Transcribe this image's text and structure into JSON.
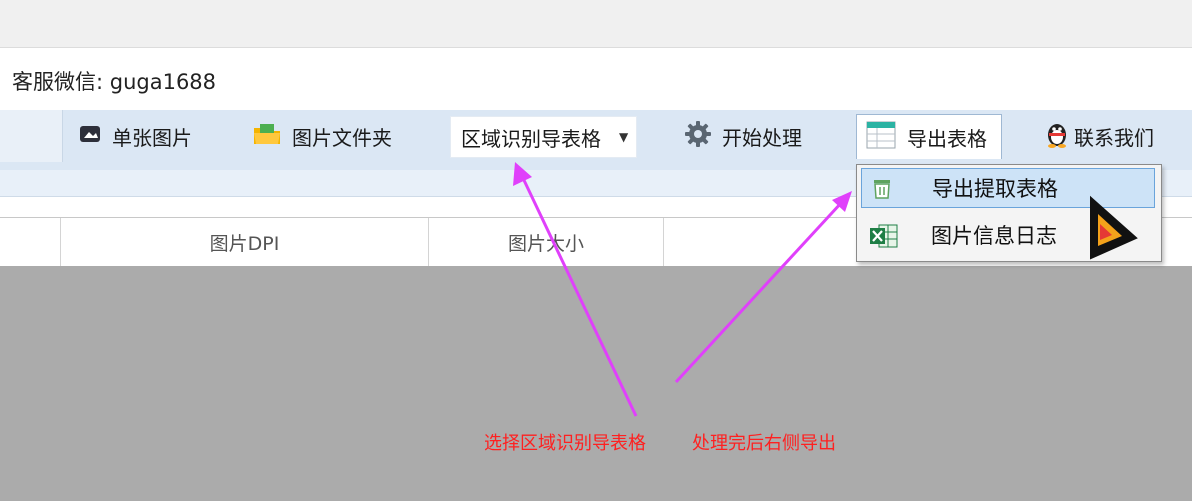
{
  "header": {
    "support_text": "客服微信: guga1688"
  },
  "toolbar": {
    "single_image": "单张图片",
    "image_folder": "图片文件夹",
    "mode_combo": "区域识别导表格",
    "start_process": "开始处理",
    "export_table": "导出表格",
    "contact_us": "联系我们"
  },
  "table": {
    "columns": [
      "图片DPI",
      "图片大小"
    ]
  },
  "export_menu": {
    "items": [
      "导出提取表格",
      "图片信息日志"
    ],
    "selected_index": 0
  },
  "annotations": {
    "left_caption": "选择区域识别导表格",
    "right_caption": "处理完后右侧导出"
  },
  "colors": {
    "toolbar_bg": "#dbe7f4",
    "selection": "#cde3f7",
    "arrow": "#e040fb",
    "caption": "#ff2020",
    "grid_body": "#ababab"
  }
}
